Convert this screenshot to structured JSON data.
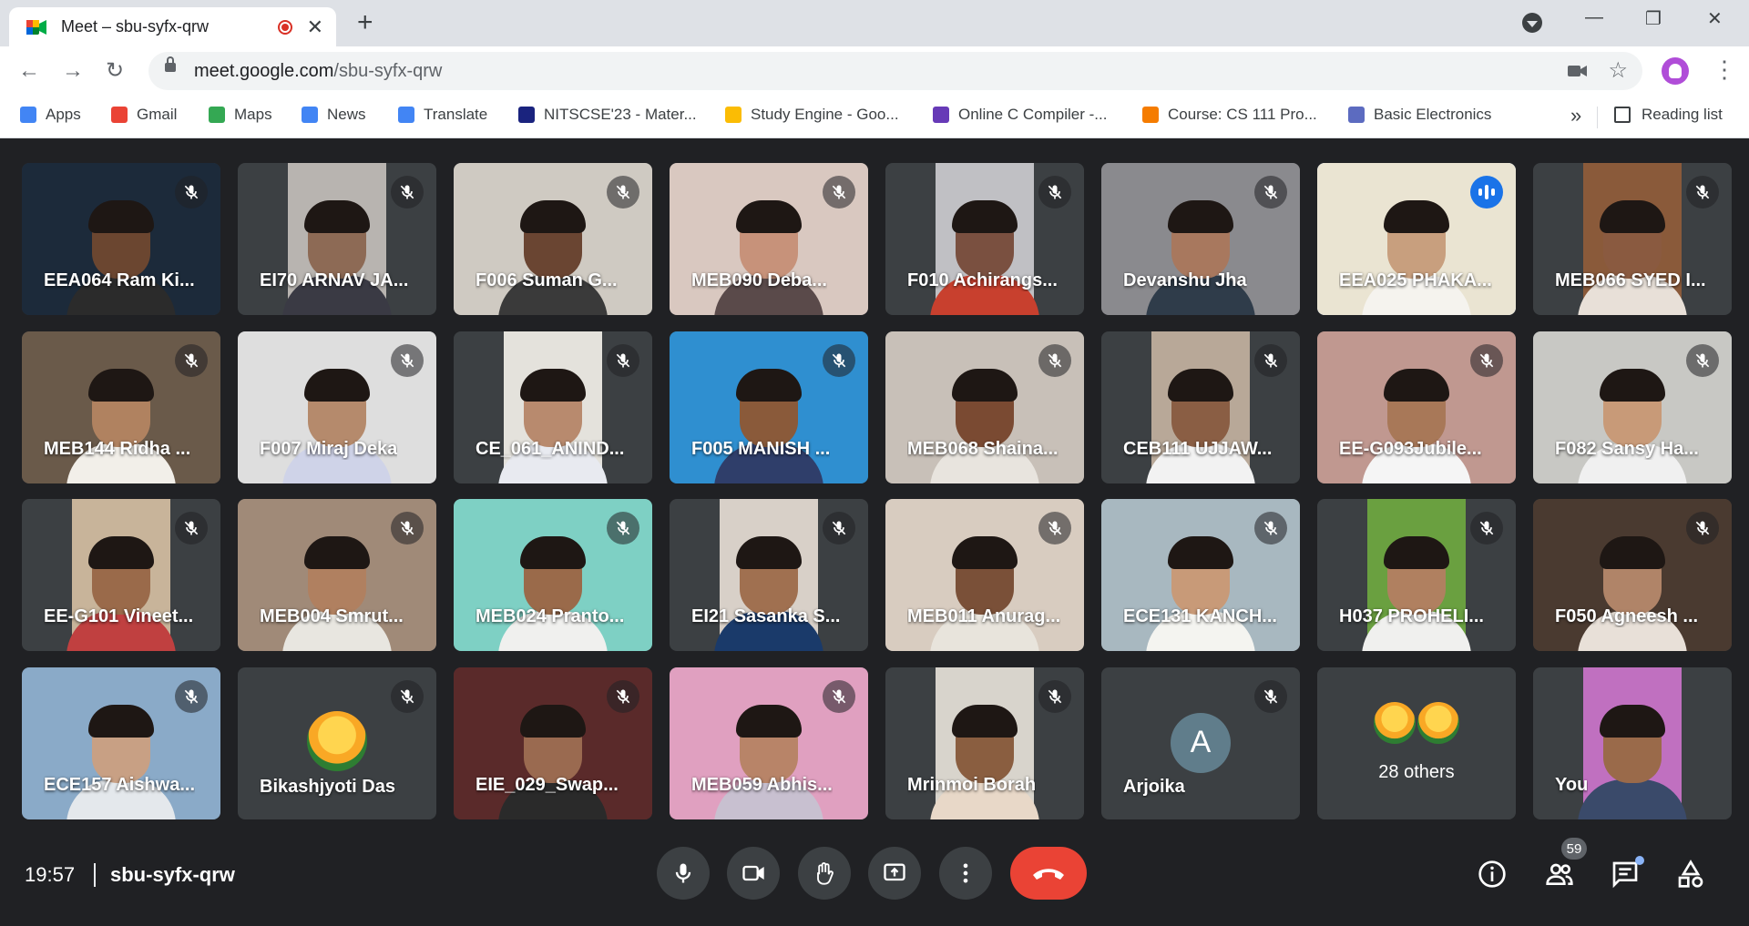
{
  "browser": {
    "tab_title": "Meet – sbu-syfx-qrw",
    "new_tab": "+",
    "url_host": "meet.google.com",
    "url_path": "/sbu-syfx-qrw",
    "bookmarks": [
      {
        "label": "Apps",
        "color": "#4285f4"
      },
      {
        "label": "Gmail",
        "color": "#ea4335"
      },
      {
        "label": "Maps",
        "color": "#34a853"
      },
      {
        "label": "News",
        "color": "#4285f4"
      },
      {
        "label": "Translate",
        "color": "#4285f4"
      },
      {
        "label": "NITSCSE'23 - Mater...",
        "color": "#1a237e"
      },
      {
        "label": "Study Engine - Goo...",
        "color": "#fbbc04"
      },
      {
        "label": "Online C Compiler -...",
        "color": "#673ab7"
      },
      {
        "label": "Course: CS 111 Pro...",
        "color": "#f57c00"
      },
      {
        "label": "Basic Electronics",
        "color": "#5c6bc0"
      }
    ],
    "more_bookmarks": "»",
    "reading_list": "Reading list"
  },
  "meet": {
    "participants": [
      {
        "name": "EEA064 Ram Ki...",
        "bg": "#1c2a3a",
        "skin": "#6b4630",
        "shirt": "#2b2b2b"
      },
      {
        "name": "EI70 ARNAV JA...",
        "bg": "#b8b4b0",
        "skin": "#8d6a55",
        "shirt": "#3a3a44"
      },
      {
        "name": "F006 Suman G...",
        "bg": "#cfcac2",
        "skin": "#6a4532",
        "shirt": "#3a3a3a"
      },
      {
        "name": "MEB090 Deba...",
        "bg": "#d9c8c0",
        "skin": "#c7927a",
        "shirt": "#5a4a4a"
      },
      {
        "name": "F010 Achirangs...",
        "bg": "#c0c0c4",
        "skin": "#7a5040",
        "shirt": "#c8402e"
      },
      {
        "name": "Devanshu Jha",
        "bg": "#8a8a8e",
        "skin": "#a8785e",
        "shirt": "#2f3c4a"
      },
      {
        "name": "EEA025 PHAKA...",
        "bg": "#eae4d2",
        "skin": "#c89f7e",
        "shirt": "#f5f3ee",
        "speaking": true
      },
      {
        "name": "MEB066 SYED I...",
        "bg": "#8a5a3a",
        "skin": "#8a5a40",
        "shirt": "#e8e0d8"
      },
      {
        "name": "MEB144 Ridha ...",
        "bg": "#6a5a4a",
        "skin": "#b08260",
        "shirt": "#f2efe9"
      },
      {
        "name": "F007 Miraj Deka",
        "bg": "#dedede",
        "skin": "#b58a6c",
        "shirt": "#cfd3e8"
      },
      {
        "name": "CE_061_ANIND...",
        "bg": "#e4e2dc",
        "skin": "#b88a6e",
        "shirt": "#e8eaf0"
      },
      {
        "name": "F005 MANISH ...",
        "bg": "#2f8fd0",
        "skin": "#8a5a3a",
        "shirt": "#2f3e6a"
      },
      {
        "name": "MEB068 Shaina...",
        "bg": "#c8c0b8",
        "skin": "#7a4a32",
        "shirt": "#e8e4de"
      },
      {
        "name": "CEB111 UJJAW...",
        "bg": "#b8a898",
        "skin": "#8a5e44",
        "shirt": "#f2f2f2"
      },
      {
        "name": "EE-G093Jubile...",
        "bg": "#c09890",
        "skin": "#a87858",
        "shirt": "#f5f5f5"
      },
      {
        "name": "F082 Sansy Ha...",
        "bg": "#c8c8c4",
        "skin": "#c89a78",
        "shirt": "#f0f0f0"
      },
      {
        "name": "EE-G101 Vineet...",
        "bg": "#c8b49a",
        "skin": "#9a6a4a",
        "shirt": "#c04040"
      },
      {
        "name": "MEB004 Smrut...",
        "bg": "#a08a78",
        "skin": "#b08060",
        "shirt": "#e8e6e0"
      },
      {
        "name": "MEB024 Pranto...",
        "bg": "#7ed0c4",
        "skin": "#9a6a4a",
        "shirt": "#f0f0ee"
      },
      {
        "name": "EI21 Sasanka S...",
        "bg": "#d8d0c8",
        "skin": "#a07050",
        "shirt": "#1a3a6a"
      },
      {
        "name": "MEB011 Anurag...",
        "bg": "#d8ccc0",
        "skin": "#7a5038",
        "shirt": "#e8e4dc"
      },
      {
        "name": "ECE131 KANCH...",
        "bg": "#a8b8c0",
        "skin": "#c89a78",
        "shirt": "#f4f4f0"
      },
      {
        "name": "H037 PROHELI...",
        "bg": "#6aa040",
        "skin": "#b08060",
        "shirt": "#f0f0ee"
      },
      {
        "name": "F050 Agneesh ...",
        "bg": "#4a3a30",
        "skin": "#b08468",
        "shirt": "#e8e0d8"
      },
      {
        "name": "ECE157 Aishwa...",
        "bg": "#8aaac8",
        "skin": "#c8a084",
        "shirt": "#e4e8ec"
      },
      {
        "name": "Bikashjyoti Das",
        "type": "logo"
      },
      {
        "name": "EIE_029_Swap...",
        "bg": "#5a2a2a",
        "skin": "#9a6a50",
        "shirt": "#2a2a2a"
      },
      {
        "name": "MEB059 Abhis...",
        "bg": "#e0a0c0",
        "skin": "#b88468",
        "shirt": "#c8c0d0"
      },
      {
        "name": "Mrinmoi Borah",
        "bg": "#d8d4cc",
        "skin": "#8a5e40",
        "shirt": "#e8d8c8"
      },
      {
        "name": "Arjoika",
        "type": "letter",
        "letter": "A"
      },
      {
        "name": "28 others",
        "type": "others"
      },
      {
        "name": "You",
        "bg": "#c070c0",
        "skin": "#9a6a4a",
        "shirt": "#3a4a6a"
      }
    ]
  },
  "bottom_bar": {
    "time": "19:57",
    "meeting_code": "sbu-syfx-qrw",
    "people_count": "59",
    "hangup_color": "#ea4335",
    "speaking_color": "#1a73e8"
  }
}
